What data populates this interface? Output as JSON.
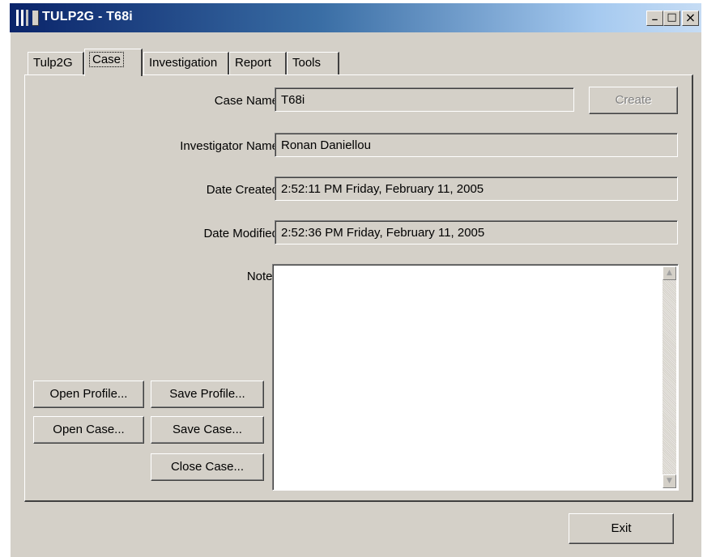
{
  "window": {
    "title": "TULP2G - T68i",
    "controls": {
      "minimize": "_",
      "maximize": "□",
      "close": "×"
    }
  },
  "tabs": [
    {
      "label": "Tulp2G"
    },
    {
      "label": "Case"
    },
    {
      "label": "Investigation"
    },
    {
      "label": "Report"
    },
    {
      "label": "Tools"
    }
  ],
  "case": {
    "case_name_label": "Case Name",
    "case_name_value": "T68i",
    "create_label": "Create",
    "investigator_label": "Investigator Name",
    "investigator_value": "Ronan Daniellou",
    "date_created_label": "Date Created",
    "date_created_value": "2:52:11 PM Friday, February 11, 2005",
    "date_modified_label": "Date Modified",
    "date_modified_value": "2:52:36 PM Friday, February 11, 2005",
    "notes_label": "Notes",
    "notes_value": ""
  },
  "buttons": {
    "open_profile": "Open Profile...",
    "save_profile": "Save Profile...",
    "open_case": "Open Case...",
    "save_case": "Save Case...",
    "close_case": "Close Case...",
    "exit": "Exit"
  }
}
